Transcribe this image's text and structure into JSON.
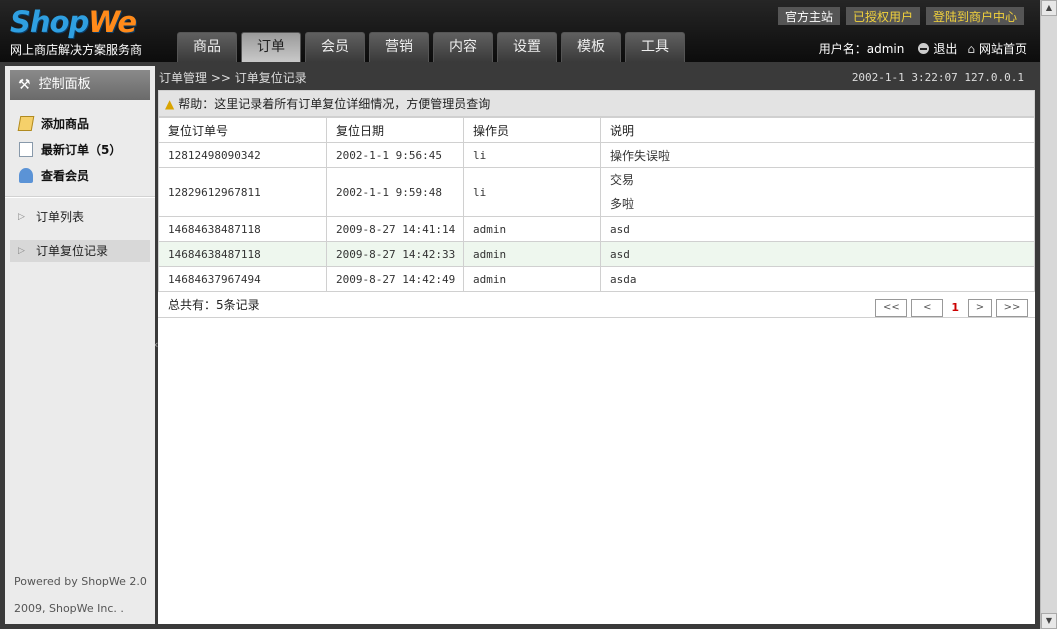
{
  "header": {
    "logo_shop": "Shop",
    "logo_we": "We",
    "slogan": "网上商店解决方案服务商",
    "tabs": [
      "商品",
      "订单",
      "会员",
      "营销",
      "内容",
      "设置",
      "模板",
      "工具"
    ],
    "active_tab": "订单",
    "top_links": [
      "官方主站",
      "已授权用户",
      "登陆到商户中心"
    ],
    "user_label": "用户名：admin",
    "logout": "退出",
    "site_home": "网站首页"
  },
  "sidebar": {
    "panel_title": "控制面板",
    "quick": [
      "添加商品",
      "最新订单（5）",
      "查看会员"
    ],
    "menu": [
      "订单列表",
      "订单复位记录"
    ],
    "powered": "Powered by ShopWe 2.0",
    "copyright": "2009, ShopWe Inc. ."
  },
  "content": {
    "breadcrumb": "订单管理 >> 订单复位记录",
    "info": "2002-1-1 3:22:07 127.0.0.1",
    "help": "帮助：这里记录着所有订单复位详细情况，方便管理员查询",
    "columns": [
      "复位订单号",
      "复位日期",
      "操作员",
      "说明"
    ],
    "rows": [
      {
        "order": "12812498090342",
        "date": "2002-1-1 9:56:45",
        "operator": "li",
        "desc": [
          "操作失误啦"
        ]
      },
      {
        "order": "12829612967811",
        "date": "2002-1-1 9:59:48",
        "operator": "li",
        "desc": [
          "交易",
          "多啦"
        ]
      },
      {
        "order": "14684638487118",
        "date": "2009-8-27 14:41:14",
        "operator": "admin",
        "desc": [
          "asd"
        ]
      },
      {
        "order": "14684638487118",
        "date": "2009-8-27 14:42:33",
        "operator": "admin",
        "desc": [
          "asd"
        ]
      },
      {
        "order": "14684637967494",
        "date": "2009-8-27 14:42:49",
        "operator": "admin",
        "desc": [
          "asda"
        ]
      }
    ],
    "total": "总共有：5条记录",
    "pager": {
      "first": "<<",
      "prev": "<",
      "current": "1",
      "next": ">",
      "last": ">>"
    }
  },
  "colors": {
    "highlight_row": "#eef7ee",
    "current_page": "#cc0000",
    "logo_blue": "#2f9fe0",
    "logo_orange": "#ff8a1a"
  }
}
